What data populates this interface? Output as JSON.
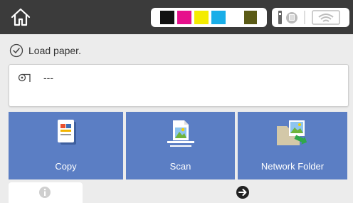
{
  "topbar": {
    "home_icon": "home-icon",
    "ink_colors": [
      "#111111",
      "#e6108c",
      "#f4ec00",
      "#19aee8",
      "#5a5a16"
    ],
    "status_icons": [
      "ink-maintenance-icon",
      "wifi-disconnected-icon"
    ]
  },
  "message": {
    "icon": "check-circle-icon",
    "text": "Load paper."
  },
  "paper_source": {
    "icon": "paper-roll-icon",
    "text": "---"
  },
  "tiles": [
    {
      "label": "Copy",
      "icon": "copy-icon"
    },
    {
      "label": "Scan",
      "icon": "scan-icon"
    },
    {
      "label": "Network Folder",
      "icon": "network-folder-icon"
    }
  ],
  "bottom": {
    "info_icon": "info-icon",
    "next_icon": "arrow-right-circle-icon"
  },
  "colors": {
    "topbar": "#3b3b3b",
    "tile": "#5b7ec4",
    "background": "#ececec"
  }
}
